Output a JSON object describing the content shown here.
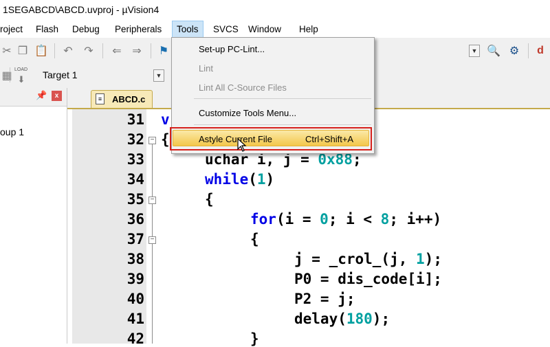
{
  "window": {
    "title": "1SEGABCD\\ABCD.uvproj - µVision4"
  },
  "menubar": {
    "items": [
      {
        "label": "roject"
      },
      {
        "label": "Flash"
      },
      {
        "label": "Debug"
      },
      {
        "label": "Peripherals"
      },
      {
        "label": "Tools"
      },
      {
        "label": "SVCS"
      },
      {
        "label": "Window"
      },
      {
        "label": "Help"
      }
    ]
  },
  "toolbar": {
    "target": "Target 1",
    "load_label": "LOAD"
  },
  "project_panel": {
    "group_label": "oup 1"
  },
  "editor": {
    "tab_label": "ABCD.c",
    "line_numbers": [
      "31",
      "32",
      "33",
      "34",
      "35",
      "36",
      "37",
      "38",
      "39",
      "40",
      "41",
      "42"
    ]
  },
  "tools_menu": {
    "items": [
      {
        "label": "Set-up PC-Lint...",
        "enabled": true
      },
      {
        "label": "Lint",
        "enabled": false
      },
      {
        "label": "Lint All C-Source Files",
        "enabled": false
      },
      {
        "label": "Customize Tools Menu...",
        "enabled": true
      },
      {
        "label": "Astyle Current File",
        "shortcut": "Ctrl+Shift+A",
        "enabled": true,
        "highlighted": true
      }
    ]
  },
  "colors": {
    "keyword": "#0000e6",
    "number": "#00a0a0",
    "highlight": "#f3c74b",
    "annotation": "#d6201a"
  }
}
